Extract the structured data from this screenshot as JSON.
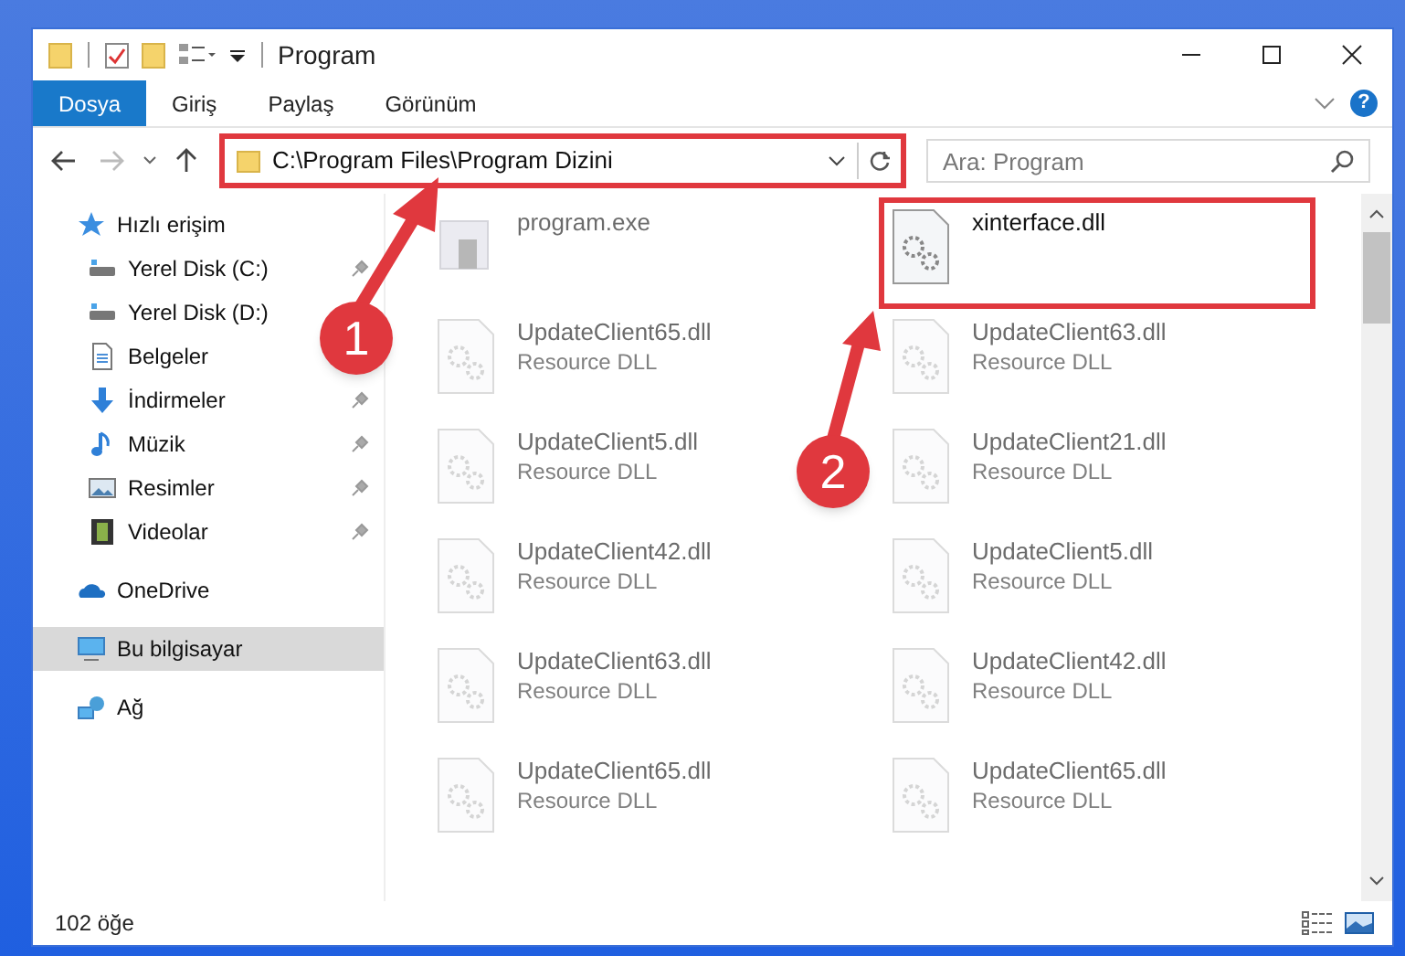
{
  "window": {
    "title": "Program"
  },
  "ribbon_tabs": [
    {
      "label": "Dosya",
      "selected": true
    },
    {
      "label": "Giriş",
      "selected": false
    },
    {
      "label": "Paylaş",
      "selected": false
    },
    {
      "label": "Görünüm",
      "selected": false
    }
  ],
  "help_glyph": "?",
  "address_bar": {
    "value": "C:\\Program Files\\Program Dizini",
    "highlighted": true
  },
  "search": {
    "placeholder": "Ara: Program"
  },
  "sidebar": {
    "items": [
      {
        "label": "Hızlı erişim",
        "kind": "star",
        "selected": false,
        "children": [
          {
            "label": "Yerel Disk (C:)",
            "kind": "drive",
            "pinned": true,
            "selected": false
          },
          {
            "label": "Yerel Disk (D:)",
            "kind": "drive",
            "pinned": false,
            "selected": false
          },
          {
            "label": "Belgeler",
            "kind": "document",
            "pinned": false,
            "selected": false
          },
          {
            "label": "İndirmeler",
            "kind": "download",
            "pinned": true,
            "selected": false
          },
          {
            "label": "Müzik",
            "kind": "music",
            "pinned": true,
            "selected": false
          },
          {
            "label": "Resimler",
            "kind": "image",
            "pinned": true,
            "selected": false
          },
          {
            "label": "Videolar",
            "kind": "video",
            "pinned": true,
            "selected": false
          }
        ]
      },
      {
        "label": "OneDrive",
        "kind": "cloud",
        "selected": false
      },
      {
        "label": "Bu bilgisayar",
        "kind": "computer",
        "selected": true
      },
      {
        "label": "Ağ",
        "kind": "network",
        "selected": false
      }
    ]
  },
  "files": [
    {
      "name": "program.exe",
      "kind": "exe",
      "blurred": true,
      "highlighted": false
    },
    {
      "name": "xinterface.dll",
      "kind": "dll",
      "blurred": false,
      "highlighted": true
    },
    {
      "name": "UpdateClient65.dll",
      "type_label": "Resource DLL",
      "kind": "dll",
      "blurred": true
    },
    {
      "name": "UpdateClient63.dll",
      "type_label": "Resource DLL",
      "kind": "dll",
      "blurred": true
    },
    {
      "name": "UpdateClient5.dll",
      "type_label": "Resource DLL",
      "kind": "dll",
      "blurred": true
    },
    {
      "name": "UpdateClient21.dll",
      "type_label": "Resource DLL",
      "kind": "dll",
      "blurred": true
    },
    {
      "name": "UpdateClient42.dll",
      "type_label": "Resource DLL",
      "kind": "dll",
      "blurred": true
    },
    {
      "name": "UpdateClient5.dll",
      "type_label": "Resource DLL",
      "kind": "dll",
      "blurred": true
    },
    {
      "name": "UpdateClient63.dll",
      "type_label": "Resource DLL",
      "kind": "dll",
      "blurred": true
    },
    {
      "name": "UpdateClient42.dll",
      "type_label": "Resource DLL",
      "kind": "dll",
      "blurred": true
    },
    {
      "name": "UpdateClient65.dll",
      "type_label": "Resource DLL",
      "kind": "dll",
      "blurred": true
    },
    {
      "name": "UpdateClient65.dll",
      "type_label": "Resource DLL",
      "kind": "dll",
      "blurred": true
    }
  ],
  "status_bar": {
    "item_count": "102 öğe"
  },
  "annotations": [
    {
      "label": "1"
    },
    {
      "label": "2"
    }
  ]
}
